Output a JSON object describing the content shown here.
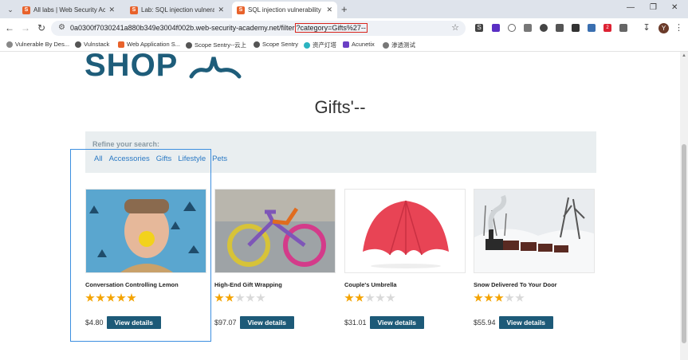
{
  "tabs": [
    {
      "title": "All labs | Web Security Acade",
      "favicon": "portswigger-icon",
      "active": false
    },
    {
      "title": "Lab: SQL injection vulnerabili",
      "favicon": "portswigger-icon",
      "active": false
    },
    {
      "title": "SQL injection vulnerability in",
      "favicon": "portswigger-icon",
      "active": true
    }
  ],
  "address_bar": {
    "url_main": "0a0300f7030241a880b349e3004f002b.web-security-academy.net/filter",
    "url_highlight": "?category=Gifts%27--"
  },
  "extension_badges": {
    "count": "2"
  },
  "profile": {
    "initial": "Y"
  },
  "bookmarks": [
    {
      "label": "Vulnerable By Des...",
      "color": "#888888"
    },
    {
      "label": "Vulnstack",
      "color": "#555555"
    },
    {
      "label": "Web Application S...",
      "color": "#e8622b"
    },
    {
      "label": "Scope Sentry--云上",
      "color": "#555555"
    },
    {
      "label": "Scope Sentry",
      "color": "#555555"
    },
    {
      "label": "资产灯塔",
      "color": "#2bb3c0"
    },
    {
      "label": "Acunetix",
      "color": "#6a3fc4"
    },
    {
      "label": "渗透测试",
      "color": "#777777"
    }
  ],
  "shop": {
    "logo_text": "SHOP",
    "heading": "Gifts'--",
    "refine_label": "Refine your search:",
    "filters": [
      "All",
      "Accessories",
      "Gifts",
      "Lifestyle",
      "Pets"
    ]
  },
  "products": [
    {
      "name": "Conversation Controlling Lemon",
      "price": "$4.80",
      "rating": 5,
      "button": "View details"
    },
    {
      "name": "High-End Gift Wrapping",
      "price": "$97.07",
      "rating": 2,
      "button": "View details"
    },
    {
      "name": "Couple's Umbrella",
      "price": "$31.01",
      "rating": 2,
      "button": "View details"
    },
    {
      "name": "Snow Delivered To Your Door",
      "price": "$55.94",
      "rating": 3,
      "button": "View details"
    }
  ],
  "colors": {
    "brand": "#1d5a78",
    "link": "#2a79c4",
    "star": "#f4a300",
    "highlight_border": "#d9251d",
    "selection_border": "#3d8fe0"
  }
}
